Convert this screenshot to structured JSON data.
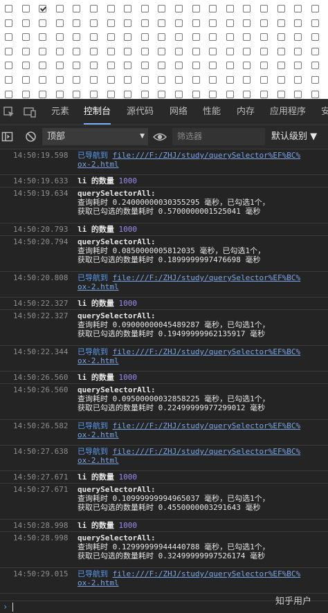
{
  "checkbox_grid": {
    "rows": 7,
    "cols": 20,
    "checked": [
      [
        0,
        2
      ]
    ]
  },
  "tabs": [
    {
      "label": "元素"
    },
    {
      "label": "控制台",
      "active": true
    },
    {
      "label": "源代码"
    },
    {
      "label": "网络"
    },
    {
      "label": "性能"
    },
    {
      "label": "内存"
    },
    {
      "label": "应用程序"
    },
    {
      "label": "安"
    }
  ],
  "toolbar": {
    "context": "顶部",
    "filter_placeholder": "筛选器",
    "levels": "默认级别 ▼"
  },
  "log": [
    {
      "ts": "14:50:19.598",
      "kind": "nav",
      "prefix": "已导航到 ",
      "url1": "file:///F:/ZHJ/study/querySelector%EF%BC%",
      "url2": "ox-2.html"
    },
    {
      "ts": "14:50:19.633",
      "kind": "count",
      "text": "li 的数量 ",
      "num": "1000"
    },
    {
      "ts": "14:50:19.634",
      "kind": "timing",
      "title": "querySelectorAll:",
      "line1": "查询耗时 0.24000000030355295 毫秒，已勾选1个，",
      "line2": "获取已勾选的数量耗时 0.5700000001525041 毫秒"
    },
    {
      "ts": "14:50:20.793",
      "kind": "count",
      "text": "li 的数量 ",
      "num": "1000"
    },
    {
      "ts": "14:50:20.794",
      "kind": "timing",
      "title": "querySelectorAll:",
      "line1": "查询耗时 0.0850000005812035 毫秒，已勾选1个，",
      "line2": "获取已勾选的数量耗时 0.1899999997476698 毫秒"
    },
    {
      "ts": "14:50:20.808",
      "kind": "nav",
      "prefix": "已导航到 ",
      "url1": "file:///F:/ZHJ/study/querySelector%EF%BC%",
      "url2": "ox-2.html"
    },
    {
      "ts": "14:50:22.327",
      "kind": "count",
      "text": "li 的数量 ",
      "num": "1000"
    },
    {
      "ts": "14:50:22.327",
      "kind": "timing",
      "title": "querySelectorAll:",
      "line1": "查询耗时 0.09000000045489287 毫秒，已勾选1个，",
      "line2": "获取已勾选的数量耗时 0.19499999962135917 毫秒"
    },
    {
      "ts": "14:50:22.344",
      "kind": "nav",
      "prefix": "已导航到 ",
      "url1": "file:///F:/ZHJ/study/querySelector%EF%BC%",
      "url2": "ox-2.html"
    },
    {
      "ts": "14:50:26.560",
      "kind": "count",
      "text": "li 的数量 ",
      "num": "1000"
    },
    {
      "ts": "14:50:26.560",
      "kind": "timing",
      "title": "querySelectorAll:",
      "line1": "查询耗时 0.09500000032858225 毫秒，已勾选1个，",
      "line2": "获取已勾选的数量耗时 0.22499999977299012 毫秒"
    },
    {
      "ts": "14:50:26.582",
      "kind": "nav",
      "prefix": "已导航到 ",
      "url1": "file:///F:/ZHJ/study/querySelector%EF%BC%",
      "url2": "ox-2.html"
    },
    {
      "ts": "14:50:27.638",
      "kind": "nav",
      "prefix": "已导航到 ",
      "url1": "file:///F:/ZHJ/study/querySelector%EF%BC%",
      "url2": "ox-2.html"
    },
    {
      "ts": "14:50:27.671",
      "kind": "count",
      "text": "li 的数量 ",
      "num": "1000"
    },
    {
      "ts": "14:50:27.671",
      "kind": "timing",
      "title": "querySelectorAll:",
      "line1": "查询耗时 0.10999999994965037 毫秒，已勾选1个，",
      "line2": "获取已勾选的数量耗时 0.4550000003291643 毫秒"
    },
    {
      "ts": "14:50:28.998",
      "kind": "count",
      "text": "li 的数量 ",
      "num": "1000"
    },
    {
      "ts": "14:50:28.998",
      "kind": "timing",
      "title": "querySelectorAll:",
      "line1": "查询耗时 0.12999999944440788 毫秒，已勾选1个，",
      "line2": "获取已勾选的数量耗时 0.32499999997526174 毫秒"
    },
    {
      "ts": "14:50:29.015",
      "kind": "nav",
      "prefix": "已导航到 ",
      "url1": "file:///F:/ZHJ/study/querySelector%EF%BC%",
      "url2": "ox-2.html"
    }
  ],
  "prompt": {
    "caret": "›"
  },
  "watermark": "知乎用户",
  "icons": {
    "toolbar": [
      "inspect-icon",
      "device-toolbar-icon",
      "sidebar-toggle-icon",
      "clear-console-icon",
      "eye-icon"
    ]
  },
  "colors": {
    "panel_bg": "#242424",
    "nav_blue": "#5a9bf0",
    "number_purple": "#9a8cf2",
    "active_tab_underline": "#7cacf8"
  }
}
